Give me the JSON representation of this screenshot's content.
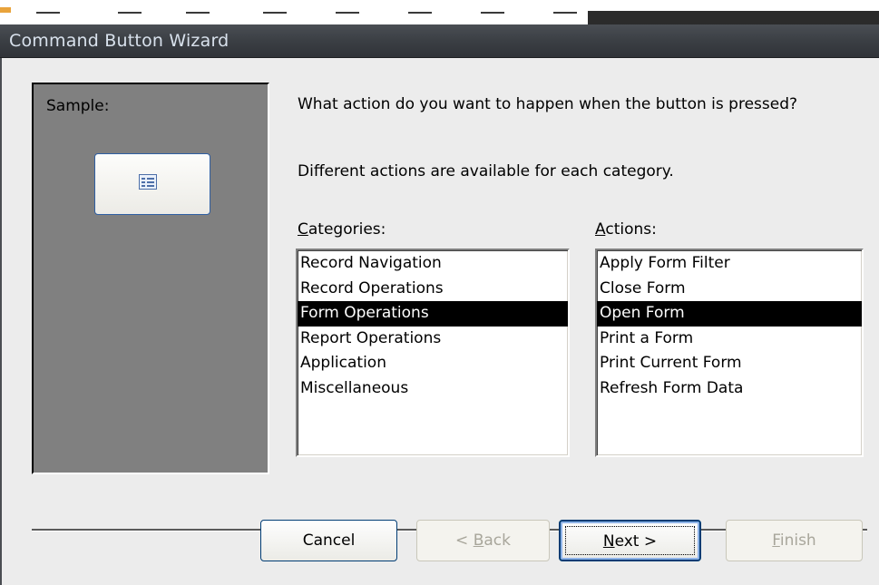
{
  "window": {
    "title": "Command Button Wizard"
  },
  "sample": {
    "label": "Sample:",
    "button_icon": "form-icon"
  },
  "prompt": {
    "question": "What action do you want to happen when the button is pressed?",
    "note": "Different actions are available for each category."
  },
  "categories": {
    "label_key": "C",
    "label_rest": "ategories:",
    "items": [
      "Record Navigation",
      "Record Operations",
      "Form Operations",
      "Report Operations",
      "Application",
      "Miscellaneous"
    ],
    "selected": "Form Operations"
  },
  "actions": {
    "label_key": "A",
    "label_rest": "ctions:",
    "items": [
      "Apply Form Filter",
      "Close Form",
      "Open Form",
      "Print a Form",
      "Print Current Form",
      "Refresh Form Data"
    ],
    "selected": "Open Form"
  },
  "buttons": {
    "cancel": "Cancel",
    "back_prefix": "< ",
    "back_key": "B",
    "back_rest": "ack",
    "next_key": "N",
    "next_rest": "ext >",
    "finish_key": "F",
    "finish_rest": "inish"
  },
  "colors": {
    "titlebar": "#3b3f44",
    "dialog_bg": "#ececec",
    "sample_panel": "#808080",
    "selection": "#000000",
    "button_border": "#003c74"
  }
}
